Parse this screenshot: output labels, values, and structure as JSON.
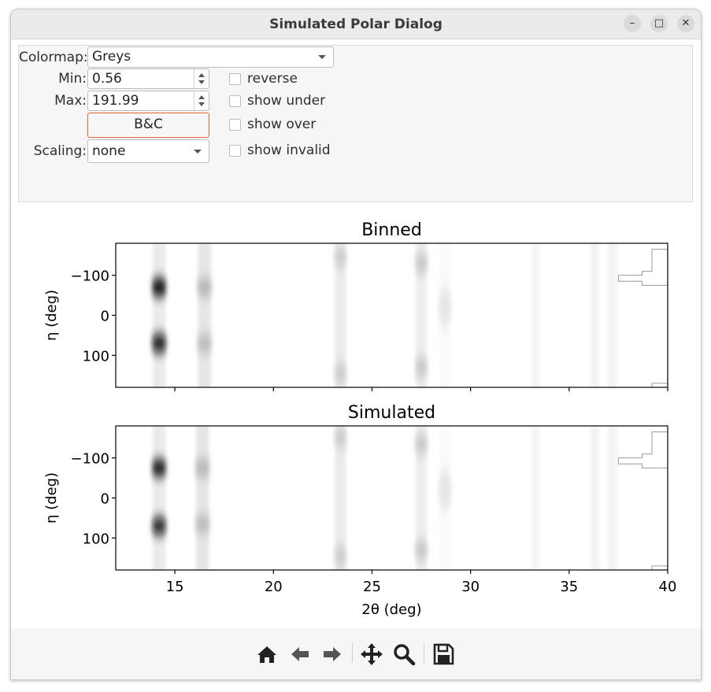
{
  "window": {
    "title": "Simulated Polar Dialog",
    "controls": {
      "minimize": "–",
      "maximize": "□",
      "close": "✕"
    }
  },
  "controls": {
    "colormap_label": "Colormap:",
    "colormap_value": "Greys",
    "min_label": "Min:",
    "min_value": "0.56",
    "max_label": "Max:",
    "max_value": "191.99",
    "bc_button": "B&C",
    "scaling_label": "Scaling:",
    "scaling_value": "none",
    "checkboxes": {
      "reverse": "reverse",
      "show_under": "show under",
      "show_over": "show over",
      "show_invalid": "show invalid"
    }
  },
  "chart_data": [
    {
      "type": "heatmap",
      "title": "Binned",
      "xlabel": "2θ (deg)",
      "ylabel": "η (deg)",
      "xlim": [
        12,
        40
      ],
      "ylim": [
        180,
        -180
      ],
      "xticks": [
        15,
        20,
        25,
        30,
        35,
        40
      ],
      "yticks": [
        -100,
        0,
        100
      ],
      "colormap": "Greys",
      "vmin": 0.56,
      "vmax": 191.99,
      "rings": [
        {
          "two_theta": 14.2,
          "intensity": 0.08,
          "width": 0.3,
          "spots": [
            {
              "eta": -70,
              "intensity": 1.0,
              "sigma": 22
            },
            {
              "eta": 70,
              "intensity": 0.95,
              "sigma": 22
            }
          ]
        },
        {
          "two_theta": 16.5,
          "intensity": 0.1,
          "width": 0.3,
          "spots": [
            {
              "eta": -70,
              "intensity": 0.3,
              "sigma": 22
            },
            {
              "eta": 70,
              "intensity": 0.28,
              "sigma": 22
            }
          ]
        },
        {
          "two_theta": 23.4,
          "intensity": 0.08,
          "width": 0.25,
          "spots": [
            {
              "eta": -145,
              "intensity": 0.2,
              "sigma": 25
            },
            {
              "eta": 145,
              "intensity": 0.2,
              "sigma": 25
            }
          ]
        },
        {
          "two_theta": 27.5,
          "intensity": 0.07,
          "width": 0.25,
          "spots": [
            {
              "eta": -130,
              "intensity": 0.22,
              "sigma": 25
            },
            {
              "eta": 130,
              "intensity": 0.22,
              "sigma": 25
            }
          ]
        },
        {
          "two_theta": 28.7,
          "intensity": 0.02,
          "width": 0.25,
          "spots": [
            {
              "eta": -20,
              "intensity": 0.1,
              "sigma": 50
            }
          ]
        },
        {
          "two_theta": 33.3,
          "intensity": 0.04,
          "width": 0.2,
          "spots": []
        },
        {
          "two_theta": 36.3,
          "intensity": 0.05,
          "width": 0.2,
          "spots": []
        },
        {
          "two_theta": 37.2,
          "intensity": 0.05,
          "width": 0.2,
          "spots": []
        }
      ]
    },
    {
      "type": "heatmap",
      "title": "Simulated",
      "xlabel": "2θ (deg)",
      "ylabel": "η (deg)",
      "xlim": [
        12,
        40
      ],
      "ylim": [
        180,
        -180
      ],
      "xticks": [
        15,
        20,
        25,
        30,
        35,
        40
      ],
      "yticks": [
        -100,
        0,
        100
      ],
      "colormap": "Greys",
      "vmin": 0.56,
      "vmax": 191.99,
      "rings": [
        {
          "two_theta": 14.2,
          "intensity": 0.08,
          "width": 0.3,
          "spots": [
            {
              "eta": -75,
              "intensity": 1.0,
              "sigma": 20
            },
            {
              "eta": 70,
              "intensity": 0.95,
              "sigma": 20
            }
          ]
        },
        {
          "two_theta": 16.4,
          "intensity": 0.1,
          "width": 0.3,
          "spots": [
            {
              "eta": -75,
              "intensity": 0.3,
              "sigma": 22
            },
            {
              "eta": 65,
              "intensity": 0.28,
              "sigma": 22
            }
          ]
        },
        {
          "two_theta": 23.4,
          "intensity": 0.08,
          "width": 0.25,
          "spots": [
            {
              "eta": -150,
              "intensity": 0.2,
              "sigma": 25
            },
            {
              "eta": 145,
              "intensity": 0.2,
              "sigma": 25
            }
          ]
        },
        {
          "two_theta": 27.5,
          "intensity": 0.07,
          "width": 0.25,
          "spots": [
            {
              "eta": -135,
              "intensity": 0.22,
              "sigma": 25
            },
            {
              "eta": 130,
              "intensity": 0.22,
              "sigma": 25
            }
          ]
        },
        {
          "two_theta": 28.7,
          "intensity": 0.02,
          "width": 0.25,
          "spots": [
            {
              "eta": -20,
              "intensity": 0.1,
              "sigma": 50
            }
          ]
        },
        {
          "two_theta": 33.3,
          "intensity": 0.04,
          "width": 0.2,
          "spots": []
        },
        {
          "two_theta": 36.3,
          "intensity": 0.05,
          "width": 0.2,
          "spots": []
        },
        {
          "two_theta": 37.2,
          "intensity": 0.05,
          "width": 0.2,
          "spots": []
        }
      ]
    }
  ],
  "toolbar": {
    "icons": [
      "home-icon",
      "back-arrow-icon",
      "forward-arrow-icon",
      "pan-icon",
      "zoom-icon",
      "save-icon"
    ]
  }
}
